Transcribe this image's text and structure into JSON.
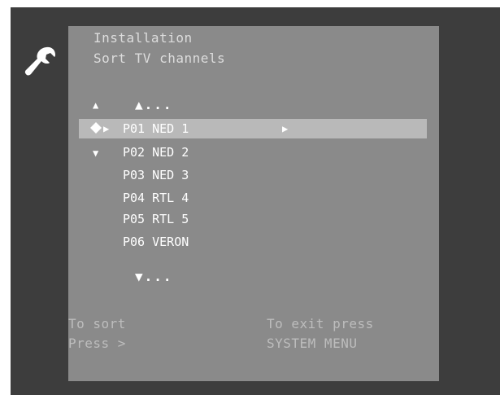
{
  "header": {
    "breadcrumb_1": "Installation",
    "breadcrumb_2": "Sort TV channels"
  },
  "list": {
    "top_more": "▲...",
    "bottom_more": "▼...",
    "channels": [
      {
        "label": "P01  NED 1",
        "selected": true
      },
      {
        "label": "P02  NED 2"
      },
      {
        "label": "P03  NED 3"
      },
      {
        "label": "P04  RTL 4"
      },
      {
        "label": "P05  RTL 5"
      },
      {
        "label": "P06  VERON"
      }
    ]
  },
  "footer": {
    "sort_line1": "To sort",
    "sort_line2": "Press  >",
    "exit_line1": "To exit press",
    "exit_line2": "SYSTEM MENU"
  },
  "colors": {
    "frame": "#3d3d3d",
    "panel": "#8a8a8a",
    "selection": "#b9b9b9",
    "text": "#ffffff"
  },
  "icons": [
    "wrench-icon",
    "up-arrow-icon",
    "down-arrow-icon",
    "cursor-diamond-icon",
    "right-arrow-icon"
  ]
}
